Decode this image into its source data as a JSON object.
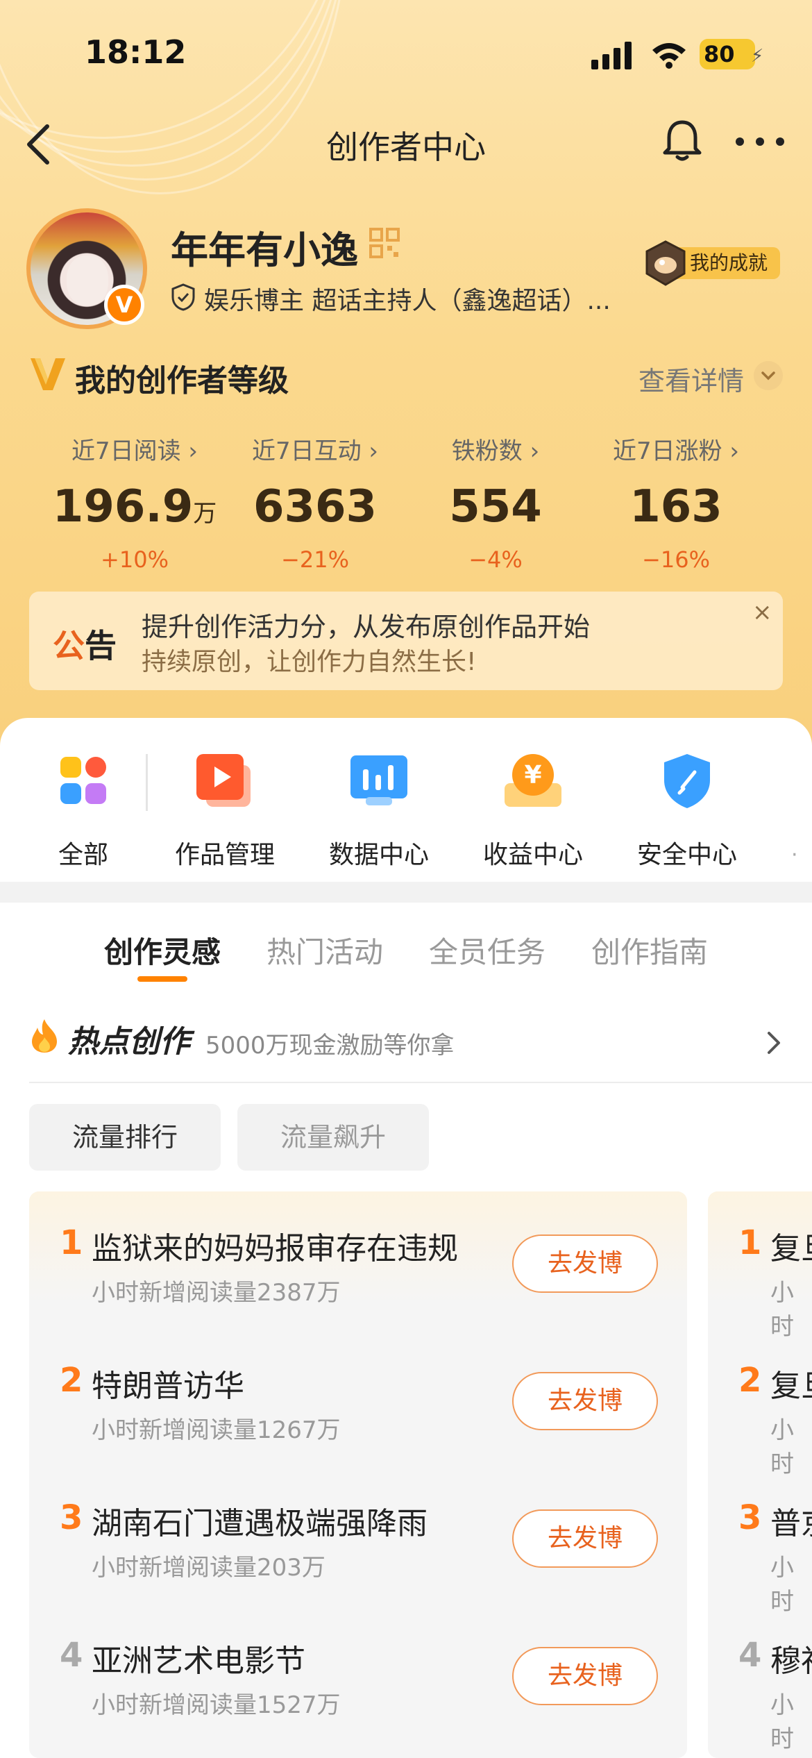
{
  "status_bar": {
    "time": "18:12",
    "battery": "80"
  },
  "nav": {
    "title": "创作者中心",
    "back_icon": "chevron-left-icon",
    "bell_icon": "bell-icon",
    "more_icon": "more-icon"
  },
  "profile": {
    "username": "年年有小逸",
    "verified_badge": "V",
    "verification": "娱乐博主 超话主持人（鑫逸超话）...",
    "achievement_label": "我的成就"
  },
  "level": {
    "title": "我的创作者等级",
    "detail_link": "查看详情"
  },
  "stats": [
    {
      "label": "近7日阅读 ›",
      "value": "196.9",
      "unit": "万",
      "change": "+10%"
    },
    {
      "label": "近7日互动 ›",
      "value": "6363",
      "unit": "",
      "change": "−21%"
    },
    {
      "label": "铁粉数 ›",
      "value": "554",
      "unit": "",
      "change": "−4%"
    },
    {
      "label": "近7日涨粉 ›",
      "value": "163",
      "unit": "",
      "change": "−16%"
    }
  ],
  "notice": {
    "tag_a": "公",
    "tag_b": "告",
    "line1": "提升创作活力分，从发布原创作品开始",
    "line2": "持续原创，让创作力自然生长!",
    "close": "×"
  },
  "shortcuts": [
    {
      "label": "全部"
    },
    {
      "label": "作品管理"
    },
    {
      "label": "数据中心"
    },
    {
      "label": "收益中心"
    },
    {
      "label": "安全中心"
    }
  ],
  "tabs": [
    {
      "label": "创作灵感",
      "active": true
    },
    {
      "label": "热门活动",
      "active": false
    },
    {
      "label": "全员任务",
      "active": false
    },
    {
      "label": "创作指南",
      "active": false
    }
  ],
  "hot": {
    "title": "热点创作",
    "subtitle": "5000万现金激励等你拿"
  },
  "chips": [
    "流量排行",
    "流量飙升"
  ],
  "ranking": [
    {
      "rank": "1",
      "title": "监狱来的妈妈报审存在违规",
      "sub": "小时新增阅读量2387万",
      "button": "去发博"
    },
    {
      "rank": "2",
      "title": "特朗普访华",
      "sub": "小时新增阅读量1267万",
      "button": "去发博"
    },
    {
      "rank": "3",
      "title": "湖南石门遭遇极端强降雨",
      "sub": "小时新增阅读量203万",
      "button": "去发博"
    },
    {
      "rank": "4",
      "title": "亚洲艺术电影节",
      "sub": "小时新增阅读量1527万",
      "button": "去发博"
    }
  ],
  "ranking2": [
    {
      "rank": "1",
      "title": "复旦",
      "sub": "小时"
    },
    {
      "rank": "2",
      "title": "复旦",
      "sub": "小时"
    },
    {
      "rank": "3",
      "title": "普京",
      "sub": "小时"
    },
    {
      "rank": "4",
      "title": "穆祉",
      "sub": "小时"
    }
  ],
  "colors": {
    "accent": "#ff8200",
    "orange_text": "#e8621e",
    "rank_gray": "#aaaaaa"
  }
}
